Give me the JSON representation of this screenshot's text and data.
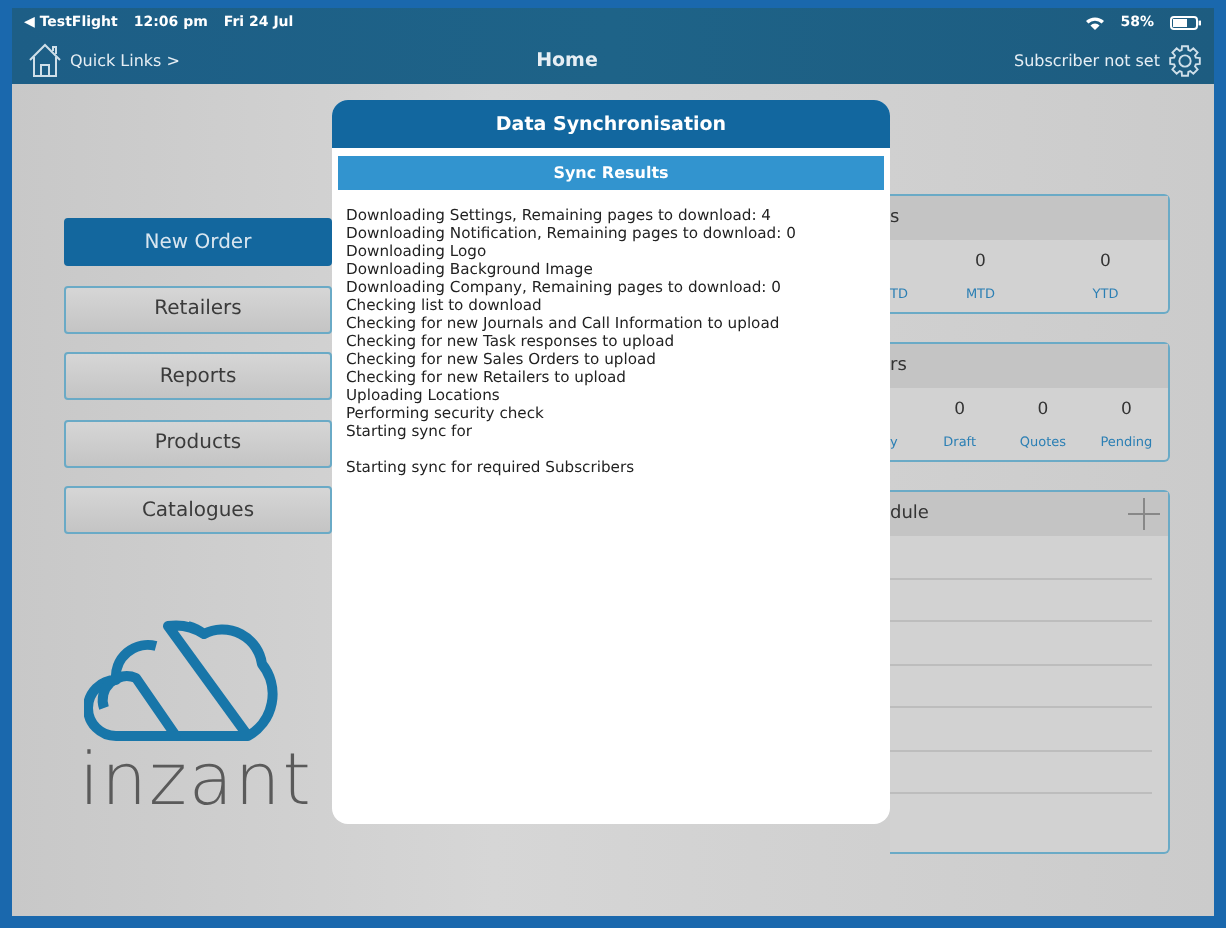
{
  "status_bar": {
    "back": "◀ TestFlight",
    "time": "12:06 pm",
    "date": "Fri 24 Jul",
    "battery": "58%"
  },
  "nav_bar": {
    "quick_links": "Quick Links >",
    "title": "Home",
    "subscriber": "Subscriber not set"
  },
  "menu": [
    {
      "label": "New Order",
      "selected": true
    },
    {
      "label": "Retailers",
      "selected": false
    },
    {
      "label": "Reports",
      "selected": false
    },
    {
      "label": "Products",
      "selected": false
    },
    {
      "label": "Catalogues",
      "selected": false
    }
  ],
  "logo": {
    "text": "inzant"
  },
  "dialog": {
    "title": "Data Synchronisation",
    "subtitle": "Sync Results",
    "lines": [
      "Downloading Settings, Remaining pages to download: 4",
      "Downloading Notification, Remaining pages to download: 0",
      "Downloading Logo",
      "Downloading Background Image",
      "Downloading Company, Remaining pages to download: 0",
      "Checking list to download",
      "Checking for new Journals and Call Information to upload",
      "Checking for new Task responses to upload",
      "Checking for new Sales Orders to upload",
      "Checking for new Retailers to upload",
      "Uploading Locations",
      "Performing security check",
      "Starting sync for"
    ],
    "final_line": "Starting sync for required Subscribers"
  },
  "cards": [
    {
      "kind": "stats",
      "title": "s",
      "stats": [
        {
          "label": "TD"
        },
        {
          "value": "0",
          "label": "MTD"
        },
        {
          "value": "0",
          "label": "YTD"
        }
      ]
    },
    {
      "kind": "stats",
      "title": "rs",
      "stats": [
        {
          "label": "y"
        },
        {
          "value": "0",
          "label": "Draft"
        },
        {
          "value": "0",
          "label": "Quotes"
        },
        {
          "value": "0",
          "label": "Pending"
        }
      ]
    },
    {
      "kind": "schedule",
      "title": "dule"
    }
  ]
}
